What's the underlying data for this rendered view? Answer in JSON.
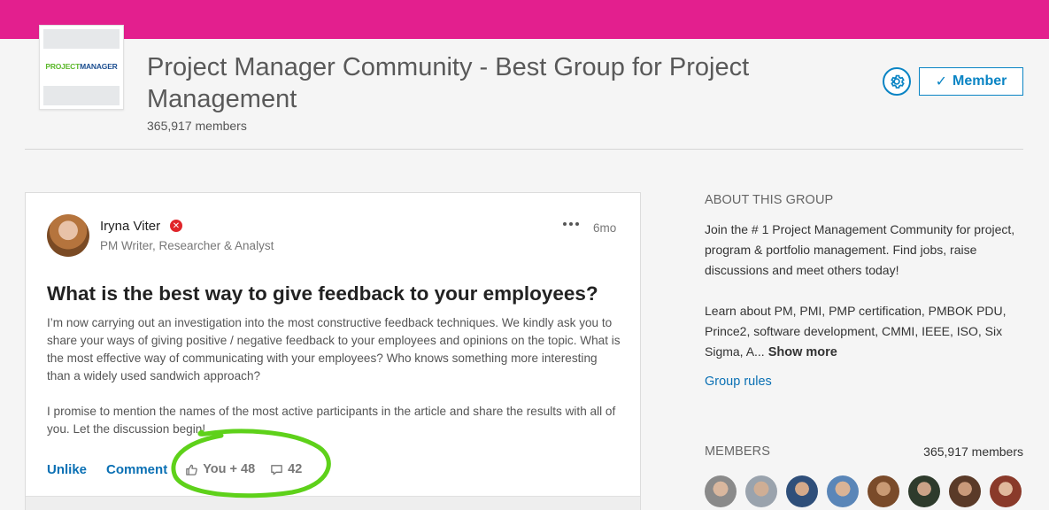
{
  "group": {
    "logo_text_part1": "PROJECT",
    "logo_text_part2": "MANAGER",
    "title": "Project Manager Community - Best Group for Project Management",
    "members_label": "365,917 members",
    "member_button": "Member",
    "member_check": "✓"
  },
  "post": {
    "author": {
      "name": "Iryna Viter",
      "headline": "PM Writer, Researcher & Analyst",
      "badge": "✕"
    },
    "time": "6mo",
    "title": "What is the best way to give feedback to your employees?",
    "body_p1": "I’m now carrying out an investigation into the most constructive feedback techniques. We kindly ask you to share your ways of giving positive / negative feedback to your employees and opinions on the topic. What is the most effective way of communicating with your employees? Who knows something more interesting than a widely used sandwich approach?",
    "body_p2": "I promise to mention the names of the most active participants in the article and share the results with all of you. Let the discussion begin!",
    "actions": {
      "unlike": "Unlike",
      "comment": "Comment",
      "likes": "You + 48",
      "comments": "42"
    }
  },
  "sidebar": {
    "about_heading": "ABOUT THIS GROUP",
    "about_p1": "Join the # 1 Project Management Community for project, program & portfolio management. Find jobs, raise discussions and meet others today!",
    "about_p2": "Learn about PM, PMI, PMP certification, PMBOK PDU, Prince2, software development, CMMI, IEEE, ISO, Six Sigma, A...",
    "show_more": "Show more",
    "group_rules": "Group rules",
    "members_heading": "MEMBERS",
    "members_count": "365,917 members"
  },
  "colors": {
    "brand_bar": "#e31f8e",
    "link": "#0a70b4",
    "annotation_circle": "#5ed11a"
  }
}
